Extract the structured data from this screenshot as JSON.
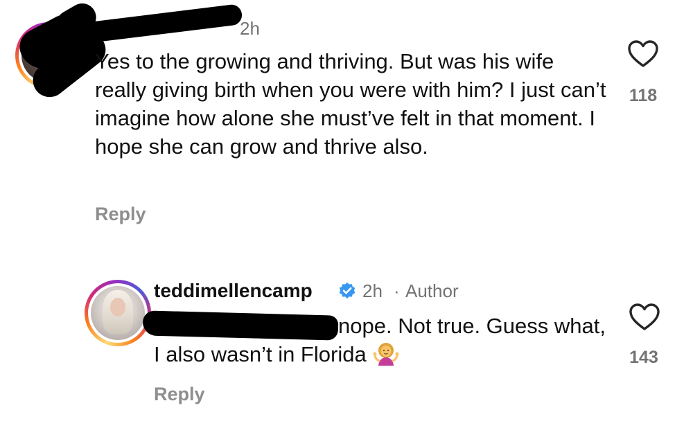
{
  "comments": [
    {
      "timestamp": "2h",
      "text": "Yes to the growing and thriving. But was his wife really giving birth when you were with him? I just can’t imagine how alone she must’ve felt in that moment. I hope she can grow and thrive also.",
      "reply_label": "Reply",
      "like_count": "118",
      "icons": {
        "like": "heart-outline-icon"
      }
    },
    {
      "username": "teddimellencamp",
      "timestamp": "2h",
      "separator": "·",
      "author_label": "Author",
      "text": "nope. Not true.  Guess what, I also wasn’t in Florida",
      "emoji": "🤷‍♀️",
      "reply_label": "Reply",
      "like_count": "143",
      "icons": {
        "verified": "verified-badge-icon",
        "like": "heart-outline-icon",
        "emoji": "woman-shrugging-emoji"
      }
    }
  ],
  "colors": {
    "verified": "#3897f0",
    "meta": "#737373",
    "reply": "#8e8e8e",
    "text": "#111111"
  }
}
